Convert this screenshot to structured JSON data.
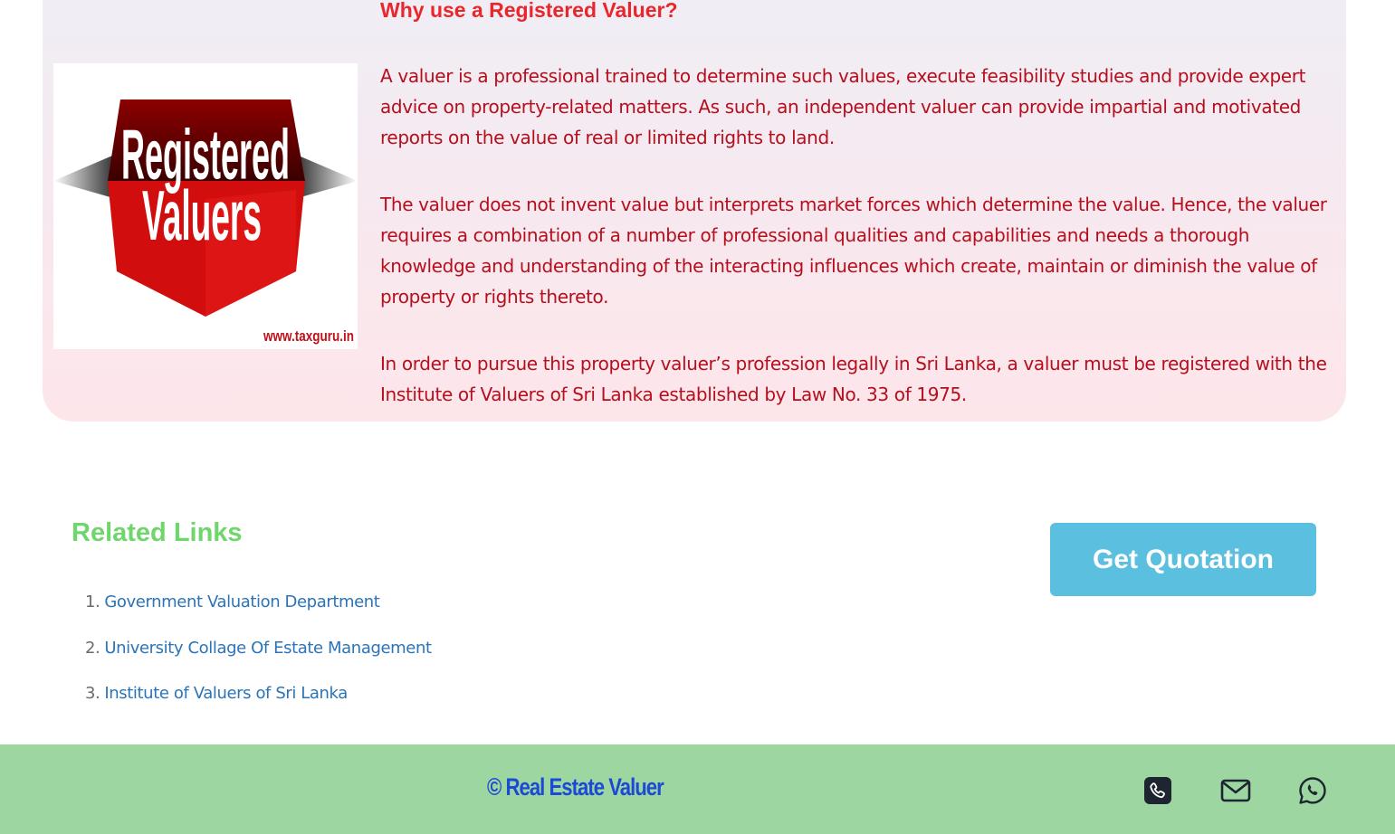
{
  "hero": {
    "title": "Why use a Registered Valuer?",
    "image": {
      "line1": "Registered",
      "line2": "Valuers",
      "watermark": "www.taxguru.in"
    },
    "paragraphs": [
      "A valuer is a professional trained to determine such values, execute feasibility studies and provide expert advice on property-related matters. As such, an independent valuer can provide impartial and motivated reports on the value of real or limited rights to land.",
      "The valuer does not invent value but interprets market forces which determine the value. Hence, the valuer requires a combination of a number of professional qualities and capabilities and needs a thorough knowledge and understanding of the interacting influences which create, maintain or diminish the value of property or rights thereto.",
      "In order to pursue this property valuer’s profession legally in Sri Lanka, a valuer must be registered with the Institute of Valuers of Sri Lanka established by Law No. 33 of 1975."
    ]
  },
  "related": {
    "title": "Related Links",
    "links": [
      {
        "num": "1.",
        "label": "Government Valuation Department"
      },
      {
        "num": "2.",
        "label": "University Collage Of Estate Management"
      },
      {
        "num": "3.",
        "label": "Institute of Valuers of Sri Lanka"
      }
    ]
  },
  "cta": {
    "label": "Get Quotation"
  },
  "footer": {
    "copyright": "© Real Estate Valuer",
    "icons": [
      "phone-icon",
      "mail-icon",
      "whatsapp-icon"
    ]
  },
  "colors": {
    "title_red": "#e8262b",
    "body_red": "#b50f1d",
    "related_green": "#6fd66c",
    "link_blue": "#2b74b8",
    "button_blue": "#5bbfdf",
    "footer_green": "#9dd6a0",
    "copyright_blue": "#1c4ad6"
  }
}
